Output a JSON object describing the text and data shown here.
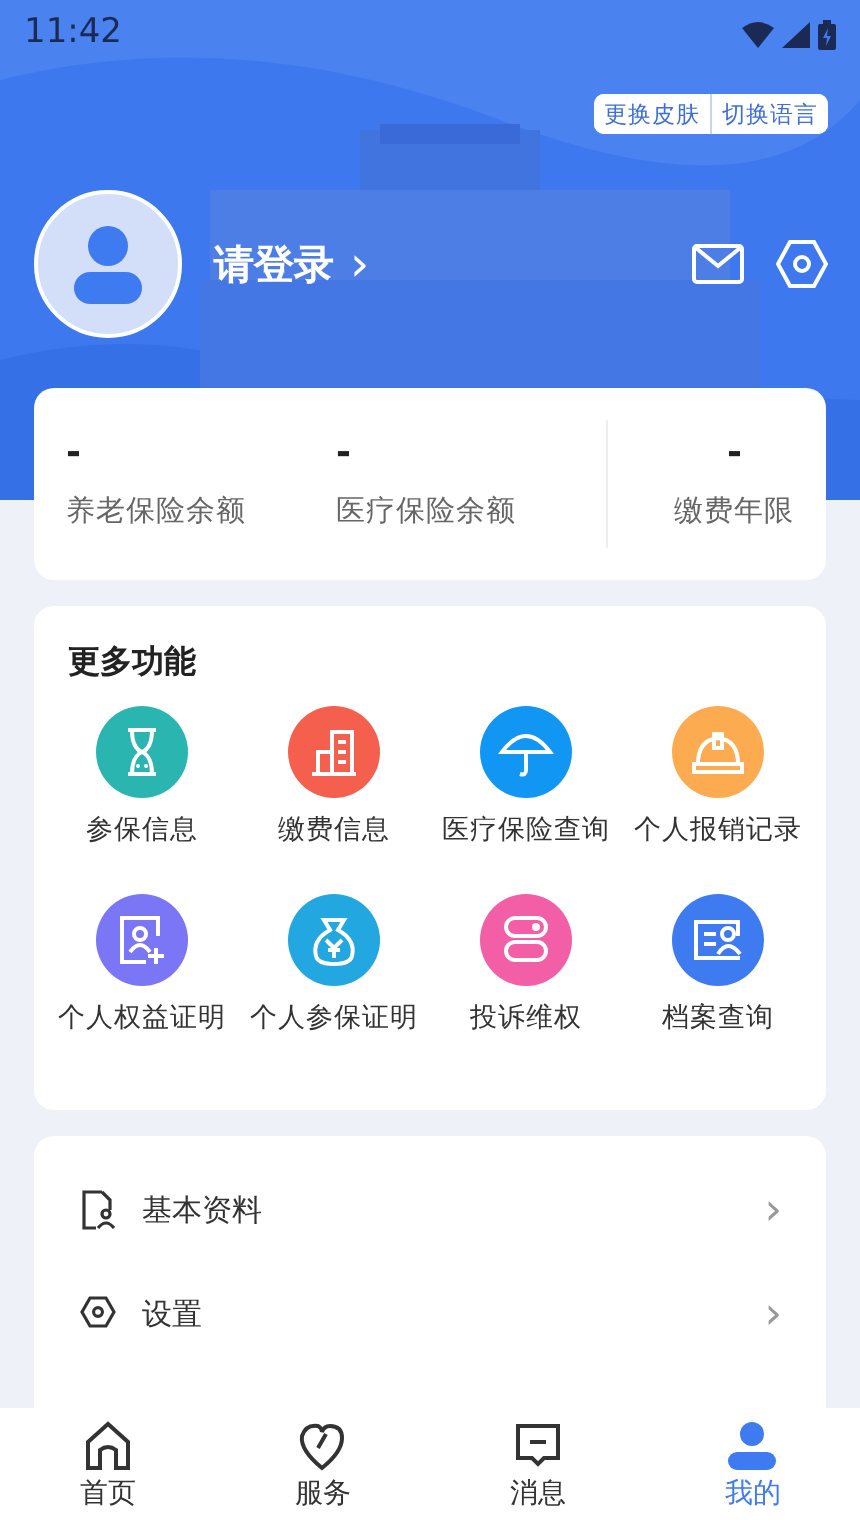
{
  "status_bar": {
    "time": "11:42"
  },
  "header": {
    "skin_buttons": [
      "更换皮肤",
      "切换语言"
    ],
    "login": "请登录",
    "login_arrow": "›"
  },
  "stats": [
    {
      "value": "-",
      "label": "养老保险余额"
    },
    {
      "value": "-",
      "label": "医疗保险余额"
    },
    {
      "value": "-",
      "label": "缴费年限"
    }
  ],
  "functions": {
    "title": "更多功能",
    "items": [
      {
        "label": "参保信息",
        "color": "#2bb5b0"
      },
      {
        "label": "缴费信息",
        "color": "#f55f4e"
      },
      {
        "label": "医疗保险查询",
        "color": "#1296f3"
      },
      {
        "label": "个人报销记录",
        "color": "#fdab50"
      },
      {
        "label": "个人权益证明",
        "color": "#7a76f5"
      },
      {
        "label": "个人参保证明",
        "color": "#22a7e0"
      },
      {
        "label": "投诉维权",
        "color": "#f35fa6"
      },
      {
        "label": "档案查询",
        "color": "#3e7af0"
      }
    ]
  },
  "menu": [
    {
      "label": "基本资料",
      "arrow": "›"
    },
    {
      "label": "设置",
      "arrow": "›"
    }
  ],
  "tab_bar": [
    {
      "label": "首页",
      "selected": false
    },
    {
      "label": "服务",
      "selected": false
    },
    {
      "label": "消息",
      "selected": false
    },
    {
      "label": "我的",
      "selected": true
    }
  ]
}
